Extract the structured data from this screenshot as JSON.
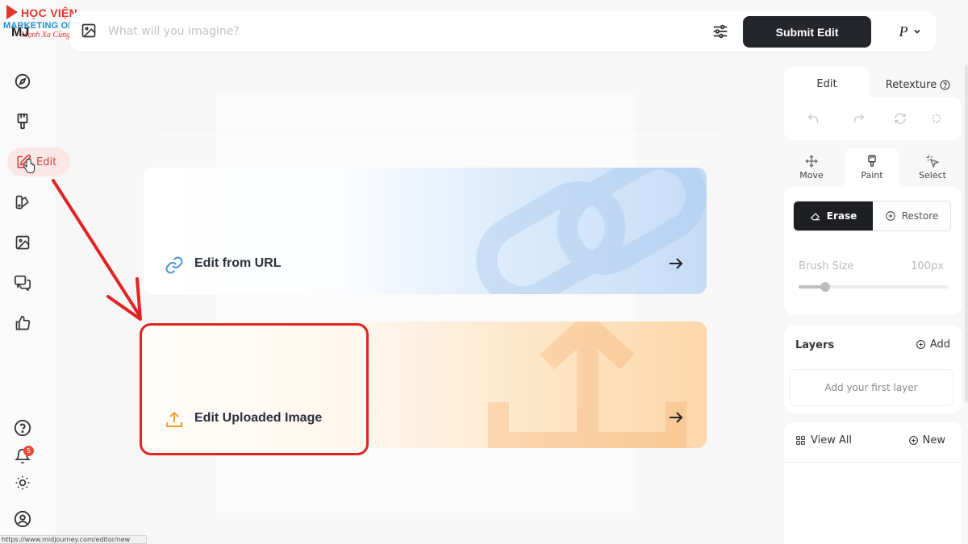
{
  "logo": {
    "line1": "HỌC VIỆN",
    "line2": "MARKETING ONLINE",
    "line3": "Mạnh Xa Cùng Bạn",
    "app_mark": "MJ"
  },
  "sidebar": {
    "items": [
      {
        "name": "explore",
        "icon": "compass-icon"
      },
      {
        "name": "create",
        "icon": "paintbrush-icon"
      },
      {
        "name": "edit",
        "icon": "edit-icon",
        "label": "Edit",
        "active": true
      },
      {
        "name": "personalize",
        "icon": "palette-icon"
      },
      {
        "name": "organize",
        "icon": "image-icon"
      },
      {
        "name": "chat",
        "icon": "chat-icon"
      },
      {
        "name": "tasks",
        "icon": "thumbs-up-icon"
      }
    ],
    "bottom": {
      "help_icon": "help-icon",
      "notifications_count": "5",
      "theme_icon": "sun-icon",
      "account_icon": "account-icon"
    }
  },
  "topbar": {
    "placeholder": "What will you imagine?",
    "submit_label": "Submit Edit",
    "profile_letter": "P"
  },
  "cards": [
    {
      "label": "Edit from URL",
      "icon": "link-icon",
      "accent": "#4a90d9"
    },
    {
      "label": "Edit Uploaded Image",
      "icon": "upload-icon",
      "accent": "#f0a12b"
    }
  ],
  "right_panel": {
    "tabs": [
      {
        "label": "Edit",
        "active": true
      },
      {
        "label": "Retexture",
        "active": false
      }
    ],
    "tools": [
      {
        "label": "Move",
        "icon": "move-icon",
        "active": false
      },
      {
        "label": "Paint",
        "icon": "paintbrush-icon",
        "active": true
      },
      {
        "label": "Select",
        "icon": "select-icon",
        "active": false
      }
    ],
    "erase_label": "Erase",
    "restore_label": "Restore",
    "brush_size_label": "Brush Size",
    "brush_size_value": "100px",
    "brush_size_fraction": 0.18,
    "layers_title": "Layers",
    "layers_add": "Add",
    "layers_empty": "Add your first layer",
    "view_all": "View All",
    "new_label": "New"
  },
  "status_url": "https://www.midjourney.com/editor/new",
  "colors": {
    "annotation": "#e02424",
    "dark_button": "#24262b",
    "edit_accent": "#d0463c"
  }
}
